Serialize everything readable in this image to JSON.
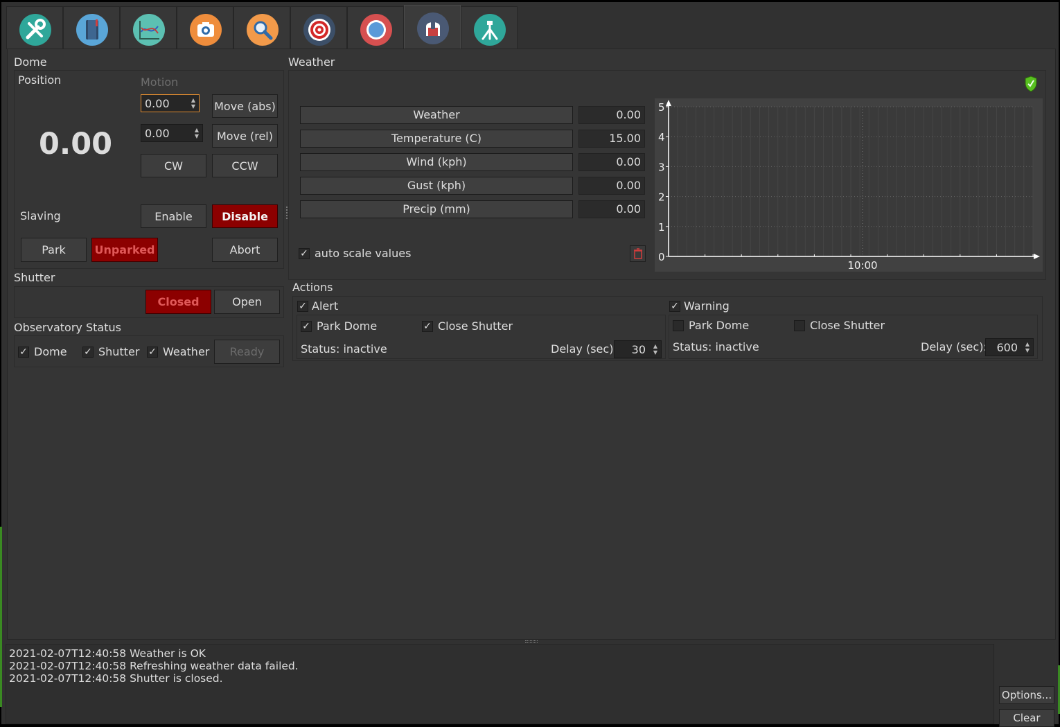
{
  "tabs": [
    {
      "name": "setup-tab",
      "icon": "tools-icon",
      "color": "#2fa79a"
    },
    {
      "name": "logbook-tab",
      "icon": "notebook-icon",
      "color": "#5aa6d8"
    },
    {
      "name": "analyze-tab",
      "icon": "chart-icon",
      "color": "#5cc0b2"
    },
    {
      "name": "capture-tab",
      "icon": "camera-icon",
      "color": "#ef8d3c"
    },
    {
      "name": "focus-tab",
      "icon": "magnifier-icon",
      "color": "#f29a4a"
    },
    {
      "name": "align-tab",
      "icon": "target-icon",
      "color": "#3c4f68"
    },
    {
      "name": "guide-tab",
      "icon": "compass-icon",
      "color": "#d65050"
    },
    {
      "name": "observatory-tab",
      "icon": "dome-icon",
      "color": "#4a5974"
    },
    {
      "name": "mount-tab",
      "icon": "tripod-icon",
      "color": "#2fa79a"
    }
  ],
  "dome": {
    "title": "Dome",
    "position_label": "Position",
    "position_value": "0.00",
    "motion_label": "Motion",
    "abs_value": "0.00",
    "rel_value": "0.00",
    "move_abs": "Move (abs)",
    "move_rel": "Move (rel)",
    "cw": "CW",
    "ccw": "CCW",
    "slaving_label": "Slaving",
    "enable": "Enable",
    "disable": "Disable",
    "park": "Park",
    "unparked": "Unparked",
    "abort": "Abort"
  },
  "shutter": {
    "title": "Shutter",
    "closed": "Closed",
    "open": "Open"
  },
  "status": {
    "title": "Observatory Status",
    "dome": "Dome",
    "shutter": "Shutter",
    "weather": "Weather",
    "ready": "Ready"
  },
  "weather": {
    "title": "Weather",
    "rows": [
      {
        "label": "Weather",
        "value": "0.00"
      },
      {
        "label": "Temperature (C)",
        "value": "15.00"
      },
      {
        "label": "Wind (kph)",
        "value": "0.00"
      },
      {
        "label": "Gust (kph)",
        "value": "0.00"
      },
      {
        "label": "Precip (mm)",
        "value": "0.00"
      }
    ],
    "autoscale": "auto scale values",
    "status_color": "#58c020"
  },
  "chart_data": {
    "type": "line",
    "yticks": [
      "5",
      "4",
      "3",
      "2",
      "1",
      "0"
    ],
    "ylim": [
      0,
      5
    ],
    "xticks": [
      "10:00"
    ],
    "series": []
  },
  "actions": {
    "title": "Actions",
    "alert": {
      "label": "Alert",
      "park": "Park Dome",
      "close": "Close Shutter",
      "status": "Status: inactive",
      "delay_label": "Delay (sec):",
      "delay": "30"
    },
    "warning": {
      "label": "Warning",
      "park": "Park Dome",
      "close": "Close Shutter",
      "status": "Status: inactive",
      "delay_label": "Delay (sec):",
      "delay": "600"
    }
  },
  "log": {
    "lines": [
      "2021-02-07T12:40:58 Weather is OK",
      "2021-02-07T12:40:58 Refreshing weather data failed.",
      "2021-02-07T12:40:58 Shutter is closed."
    ],
    "options": "Options...",
    "clear": "Clear"
  }
}
